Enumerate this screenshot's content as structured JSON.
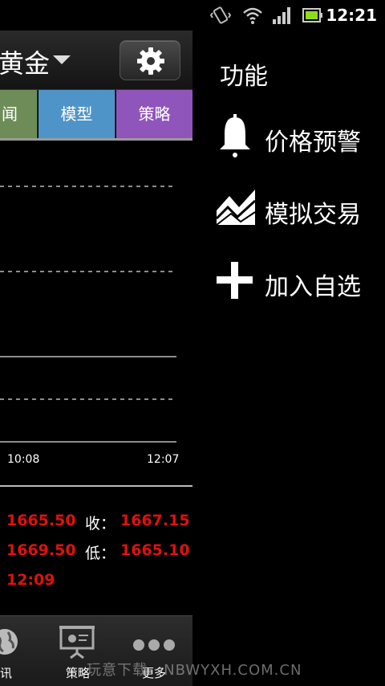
{
  "status_bar": {
    "time": "12:21",
    "icons": [
      "vibrate-icon",
      "wifi-icon",
      "signal-icon",
      "battery-icon"
    ]
  },
  "app": {
    "header": {
      "title": "黄金",
      "settings_icon": "gear-icon"
    },
    "tabs": [
      {
        "label": "闻"
      },
      {
        "label": "模型"
      },
      {
        "label": "策略"
      }
    ],
    "chart": {
      "time_labels": [
        "10:08",
        "12:07"
      ]
    },
    "quotes": {
      "row1_value": "1665.50",
      "close_label": "收：",
      "close_value": "1667.15",
      "row2_value": "1669.50",
      "low_label": "低：",
      "low_value": "1665.10",
      "time": "12:09"
    },
    "bottom_nav": [
      {
        "label": "讯",
        "icon": "globe-icon"
      },
      {
        "label": "策略",
        "icon": "presentation-icon"
      },
      {
        "label": "更多",
        "icon": "more-dots-icon"
      }
    ]
  },
  "menu": {
    "title": "功能",
    "items": [
      {
        "label": "价格预警",
        "icon": "bell-icon"
      },
      {
        "label": "模拟交易",
        "icon": "mountain-chart-icon"
      },
      {
        "label": "加入自选",
        "icon": "plus-icon"
      }
    ]
  },
  "watermark": "玩意下载 · NBWYXH.COM.CN",
  "colors": {
    "tab_news": "#6e8c58",
    "tab_model": "#4f94c8",
    "tab_strategy": "#9055bb",
    "price_red": "#e01010"
  }
}
